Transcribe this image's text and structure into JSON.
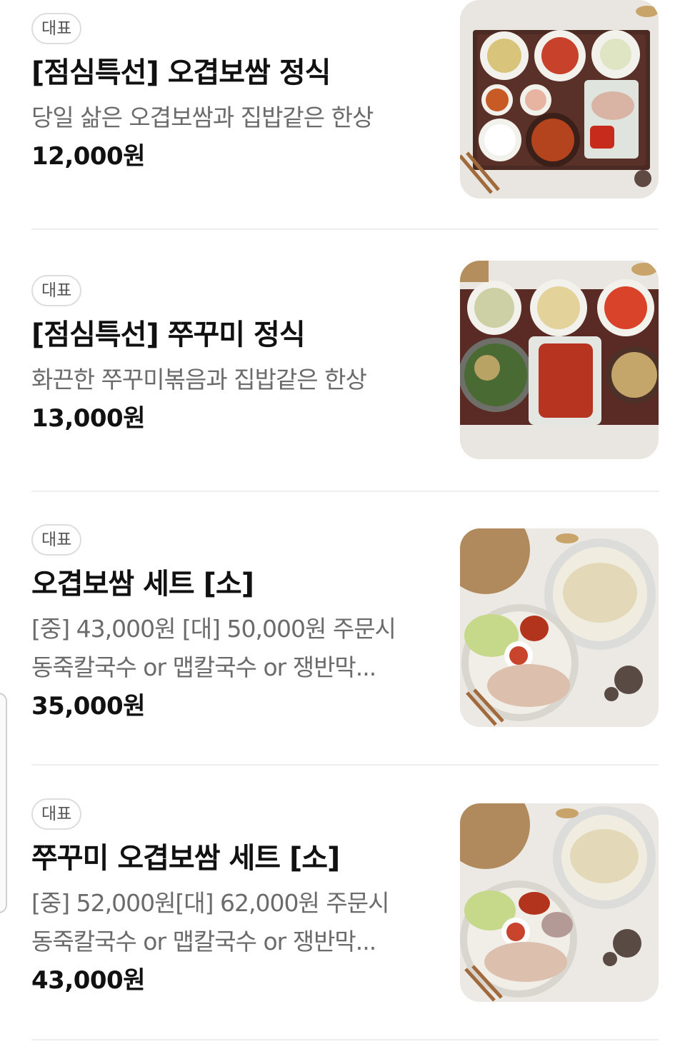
{
  "menu": {
    "items": [
      {
        "badge": "대표",
        "title": "[점심특선] 오겹보쌈 정식",
        "desc_lines": [
          "당일 삶은 오겹보쌈과 집밥같은 한상"
        ],
        "price": "12,000원",
        "image_icon": "lunch-set-bossam-photo"
      },
      {
        "badge": "대표",
        "title": "[점심특선] 쭈꾸미 정식",
        "desc_lines": [
          "화끈한 쭈꾸미볶음과 집밥같은 한상"
        ],
        "price": "13,000원",
        "image_icon": "lunch-set-jjukkumi-photo"
      },
      {
        "badge": "대표",
        "title": "오겹보쌈 세트 [소]",
        "desc_lines": [
          "[중] 43,000원 [대] 50,000원 주문시",
          "동죽칼국수 or 맵칼국수 or 쟁반막..."
        ],
        "price": "35,000원",
        "image_icon": "bossam-set-photo"
      },
      {
        "badge": "대표",
        "title": "쭈꾸미 오겹보쌈 세트 [소]",
        "desc_lines": [
          "[중] 52,000원[대] 62,000원 주문시",
          "동죽칼국수 or 맵칼국수 or 쟁반막..."
        ],
        "price": "43,000원",
        "image_icon": "jjukkumi-bossam-set-photo"
      }
    ]
  }
}
